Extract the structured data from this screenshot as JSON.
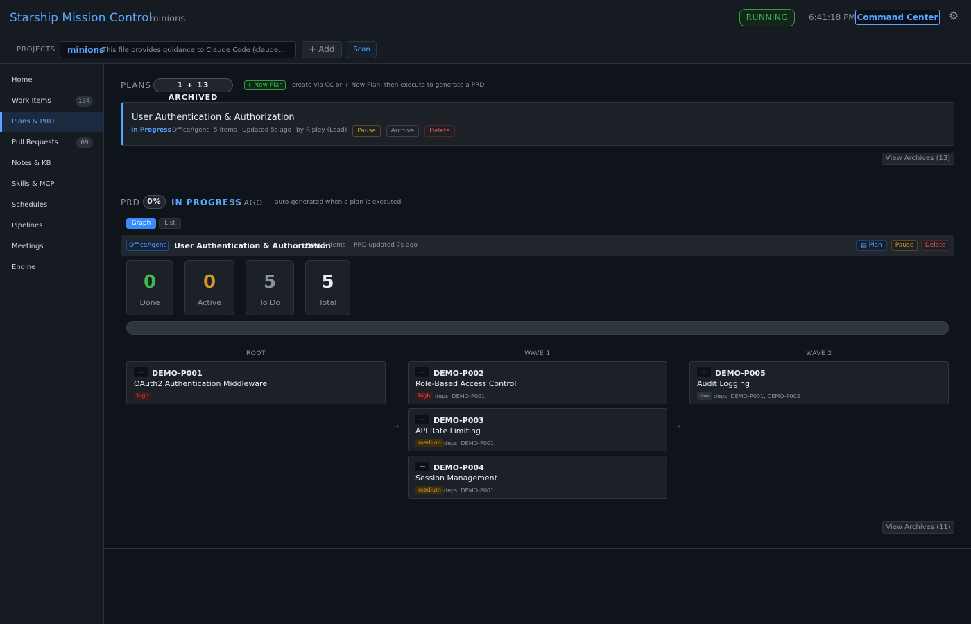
{
  "header": {
    "title": "Starship Mission Control",
    "project": "minions",
    "status": "RUNNING",
    "clock": "6:41:18 PM",
    "command_center": "Command Center",
    "settings_icon": "gear-icon"
  },
  "projects_bar": {
    "label": "PROJECTS",
    "project_name": "minions",
    "project_desc": "This file provides guidance to Claude Code (claude.ai/code) when working with code in this repository.",
    "add_label": "+ Add",
    "scan_label": "Scan"
  },
  "sidebar": {
    "items": [
      {
        "label": "Home",
        "count": ""
      },
      {
        "label": "Work Items",
        "count": "134"
      },
      {
        "label": "Plans & PRD",
        "count": ""
      },
      {
        "label": "Pull Requests",
        "count": "69"
      },
      {
        "label": "Notes & KB",
        "count": ""
      },
      {
        "label": "Skills & MCP",
        "count": ""
      },
      {
        "label": "Schedules",
        "count": ""
      },
      {
        "label": "Pipelines",
        "count": ""
      },
      {
        "label": "Meetings",
        "count": ""
      },
      {
        "label": "Engine",
        "count": ""
      }
    ],
    "active_index": 2
  },
  "plans": {
    "label": "PLANS",
    "count": "1 + 13 ARCHIVED",
    "new_plan": "+ New Plan",
    "hint": "create via CC or + New Plan, then execute to generate a PRD",
    "card": {
      "title": "User Authentication & Authorization",
      "status": "In Progress",
      "agent": "OfficeAgent",
      "items": "5 items",
      "updated": "Updated 5s ago",
      "owner": "by Ripley (Lead)",
      "pause": "Pause",
      "archive": "Archive",
      "delete": "Delete"
    },
    "view_archives": "View Archives (13)"
  },
  "prd": {
    "label": "PRD",
    "percent": "0%",
    "status": "IN PROGRESS",
    "ago": "3S AGO",
    "hint": "auto-generated when a plan is executed",
    "tab_graph": "Graph",
    "tab_list": "List",
    "bar": {
      "agent": "OfficeAgent",
      "title": "User Authentication & Authorization",
      "percent": "0%",
      "meta": "5 items    PRD updated 7s ago",
      "plan": "Plan",
      "plan_icon": "document-icon",
      "pause": "Pause",
      "delete": "Delete"
    },
    "stats": [
      {
        "value": "0",
        "label": "Done",
        "color": "#3fb950"
      },
      {
        "value": "0",
        "label": "Active",
        "color": "#d29922"
      },
      {
        "value": "5",
        "label": "To Do",
        "color": "#8b949e"
      },
      {
        "value": "5",
        "label": "Total",
        "color": "#e6edf3"
      }
    ],
    "progress": 0,
    "waves": [
      "ROOT",
      "WAVE 1",
      "WAVE 2"
    ],
    "items": [
      {
        "id": "DEMO-P001",
        "title": "OAuth2 Authentication Middleware",
        "priority": "high",
        "deps": ""
      },
      {
        "id": "DEMO-P002",
        "title": "Role-Based Access Control",
        "priority": "high",
        "deps": "deps: DEMO-P001"
      },
      {
        "id": "DEMO-P003",
        "title": "API Rate Limiting",
        "priority": "medium",
        "deps": "deps: DEMO-P001"
      },
      {
        "id": "DEMO-P004",
        "title": "Session Management",
        "priority": "medium",
        "deps": "deps: DEMO-P001"
      },
      {
        "id": "DEMO-P005",
        "title": "Audit Logging",
        "priority": "low",
        "deps": "deps: DEMO-P001, DEMO-P002"
      }
    ],
    "check_glyph": "—",
    "arrow": "→",
    "view_archives": "View Archives (11)"
  }
}
